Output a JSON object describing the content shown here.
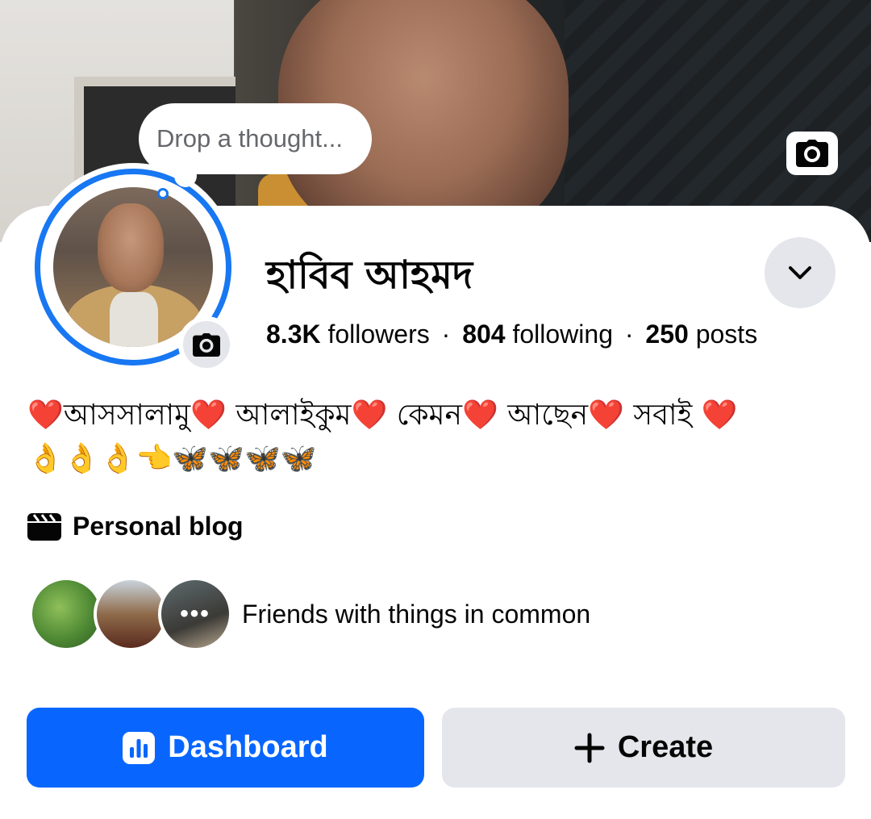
{
  "profile": {
    "thought_placeholder": "Drop a thought...",
    "name": "হাবিব আহমদ",
    "stats": {
      "followers_count": "8.3K",
      "followers_label": "followers",
      "following_count": "804",
      "following_label": "following",
      "posts_count": "250",
      "posts_label": "posts",
      "separator": "·"
    },
    "bio_line1": "❤️আসসালামু❤️ আলাইকুম❤️ কেমন❤️ আছেন❤️ সবাই ❤️",
    "bio_line2": "👌👌👌👈🦋🦋🦋🦋",
    "category": "Personal blog",
    "friends_text": "Friends with things in common",
    "friends_more": "•••"
  },
  "buttons": {
    "dashboard": "Dashboard",
    "create": "Create"
  },
  "colors": {
    "accent": "#0866ff",
    "ring": "#1877f2",
    "secondary_button": "#e4e6eb"
  },
  "icons": {
    "cover_camera": "camera-icon",
    "avatar_camera": "camera-icon",
    "chevron": "chevron-down-icon",
    "blog": "clapperboard-icon",
    "dashboard": "bar-chart-icon",
    "create": "plus-icon"
  }
}
